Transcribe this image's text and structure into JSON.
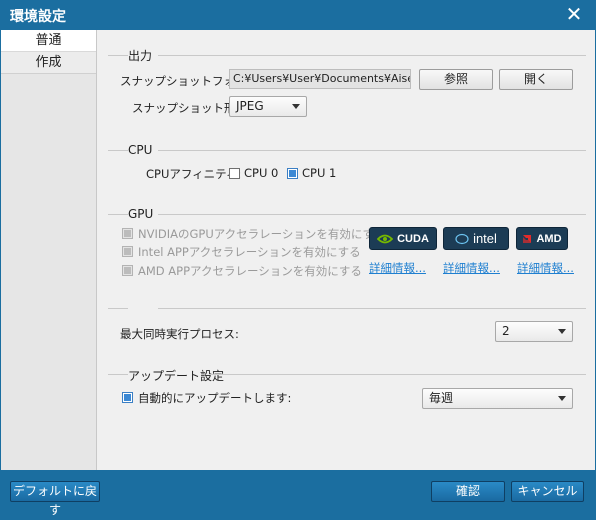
{
  "window": {
    "title": "環境設定"
  },
  "sidebar": {
    "items": [
      {
        "label": "普通"
      },
      {
        "label": "作成"
      }
    ]
  },
  "output": {
    "title": "出力",
    "folder_label": "スナップショットフォルダ:",
    "folder_value": "C:¥Users¥User¥Documents¥Aiseesoft Studio¥Snapshot",
    "browse_label": "参照",
    "open_label": "開く",
    "format_label": "スナップショット形式:",
    "format_value": "JPEG"
  },
  "cpu": {
    "title": "CPU",
    "affinity_label": "CPUアフィニティ:",
    "cores": [
      {
        "label": "CPU 0",
        "checked": false
      },
      {
        "label": "CPU 1",
        "checked": true
      }
    ]
  },
  "gpu": {
    "title": "GPU",
    "options": [
      {
        "label": "NVIDIAのGPUアクセラレーションを有効にする"
      },
      {
        "label": "Intel APPアクセラレーションを有効にする"
      },
      {
        "label": "AMD APPアクセラレーションを有効にする"
      }
    ],
    "badges": [
      {
        "label": "CUDA"
      },
      {
        "label": "intel"
      },
      {
        "label": "AMD"
      }
    ],
    "details_label": "詳細情報..."
  },
  "process": {
    "label": "最大同時実行プロセス:",
    "value": "2"
  },
  "update": {
    "title": "アップデート設定",
    "auto_label": "自動的にアップデートします:",
    "frequency": "毎週"
  },
  "footer": {
    "default_label": "デフォルトに戻す",
    "ok_label": "確認",
    "cancel_label": "キャンセル"
  },
  "colors": {
    "titlebar": "#1b6ea0",
    "link": "#1e7fd0",
    "badge": "#1c3c55",
    "nvidia": "#76b900",
    "amd": "#e22b2b"
  }
}
